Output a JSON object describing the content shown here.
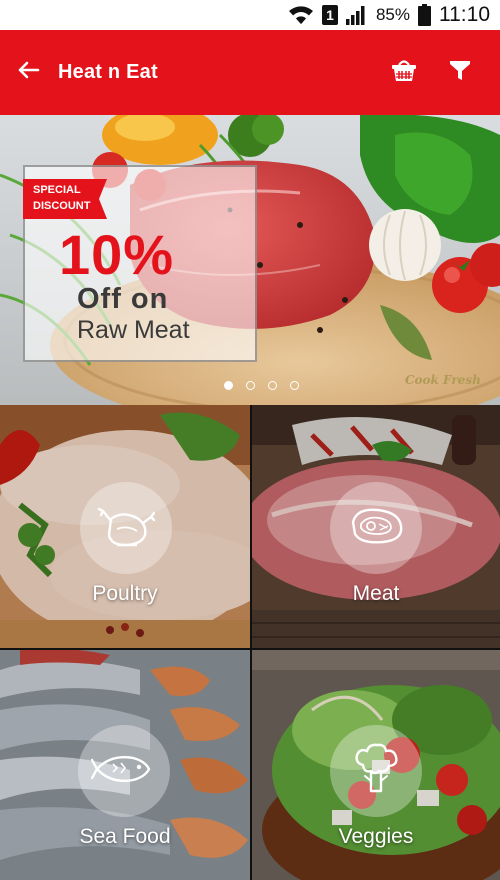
{
  "status_bar": {
    "battery": "85%",
    "time": "11:10",
    "sim": "1",
    "icons": [
      "wifi-icon",
      "sim-icon",
      "signal-icon",
      "battery-icon"
    ]
  },
  "app_bar": {
    "title": "Heat n Eat",
    "background": "#e4131b",
    "icons": [
      "back-arrow-icon",
      "basket-icon",
      "filter-icon"
    ]
  },
  "banner": {
    "ribbon": "SPECIAL DISCOUNT",
    "percent": "10%",
    "line2": "Off on",
    "line3": "Raw Meat",
    "watermark": "Cook Fresh",
    "slides": 4,
    "active_slide": 1
  },
  "categories": [
    {
      "label": "Poultry",
      "icon": "chicken-icon"
    },
    {
      "label": "Meat",
      "icon": "steak-icon"
    },
    {
      "label": "Sea Food",
      "icon": "fish-icon"
    },
    {
      "label": "Veggies",
      "icon": "broccoli-icon"
    }
  ]
}
